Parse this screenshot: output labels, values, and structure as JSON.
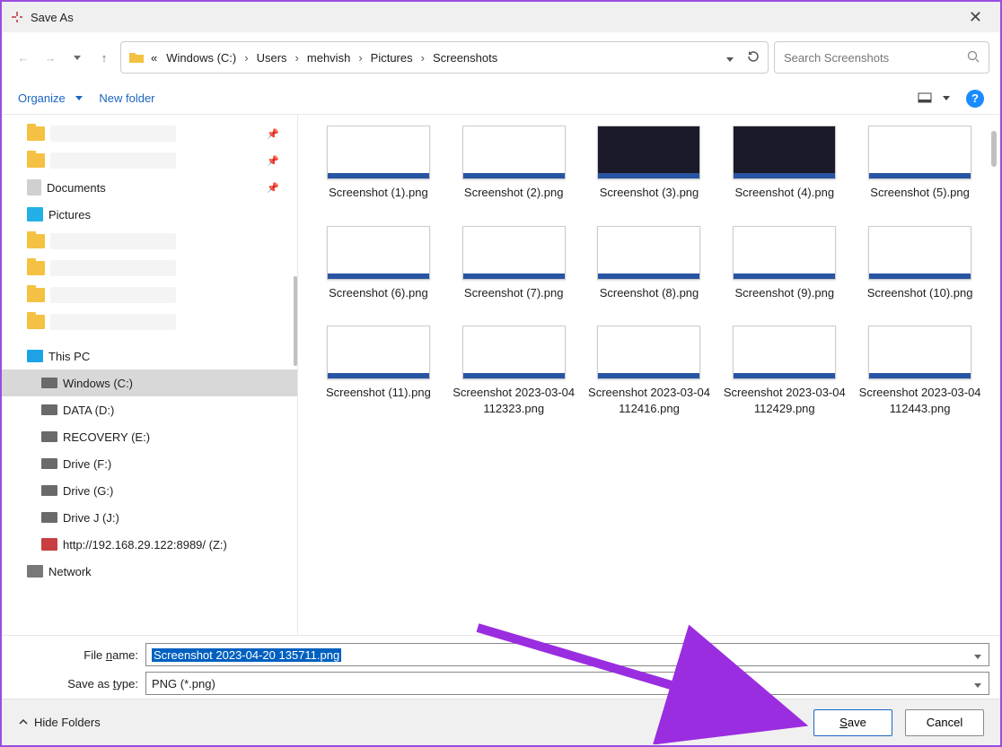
{
  "window": {
    "title": "Save As"
  },
  "nav": {
    "crumbs": [
      "«",
      "Windows (C:)",
      "Users",
      "mehvish",
      "Pictures",
      "Screenshots"
    ],
    "search_placeholder": "Search Screenshots"
  },
  "toolbar": {
    "organize": "Organize",
    "newfolder": "New folder"
  },
  "tree": {
    "documents": "Documents",
    "pictures": "Pictures",
    "thispc": "This PC",
    "cdrive": "Windows (C:)",
    "ddrive": "DATA (D:)",
    "edrive": "RECOVERY (E:)",
    "fdrive": "Drive (F:)",
    "gdrive": "Drive (G:)",
    "jdrive": "Drive J (J:)",
    "netloc": "http://192.168.29.122:8989/ (Z:)",
    "network": "Network"
  },
  "files": [
    "Screenshot (1).png",
    "Screenshot (2).png",
    "Screenshot (3).png",
    "Screenshot (4).png",
    "Screenshot (5).png",
    "Screenshot (6).png",
    "Screenshot (7).png",
    "Screenshot (8).png",
    "Screenshot (9).png",
    "Screenshot (10).png",
    "Screenshot (11).png",
    "Screenshot 2023-03-04 112323.png",
    "Screenshot 2023-03-04 112416.png",
    "Screenshot 2023-03-04 112429.png",
    "Screenshot 2023-03-04 112443.png"
  ],
  "form": {
    "filename_label": "File name:",
    "type_label": "Save as type:",
    "filename_value": "Screenshot 2023-04-20 135711.png",
    "type_value": "PNG (*.png)"
  },
  "footer": {
    "hide": "Hide Folders",
    "save": "Save",
    "cancel": "Cancel"
  }
}
